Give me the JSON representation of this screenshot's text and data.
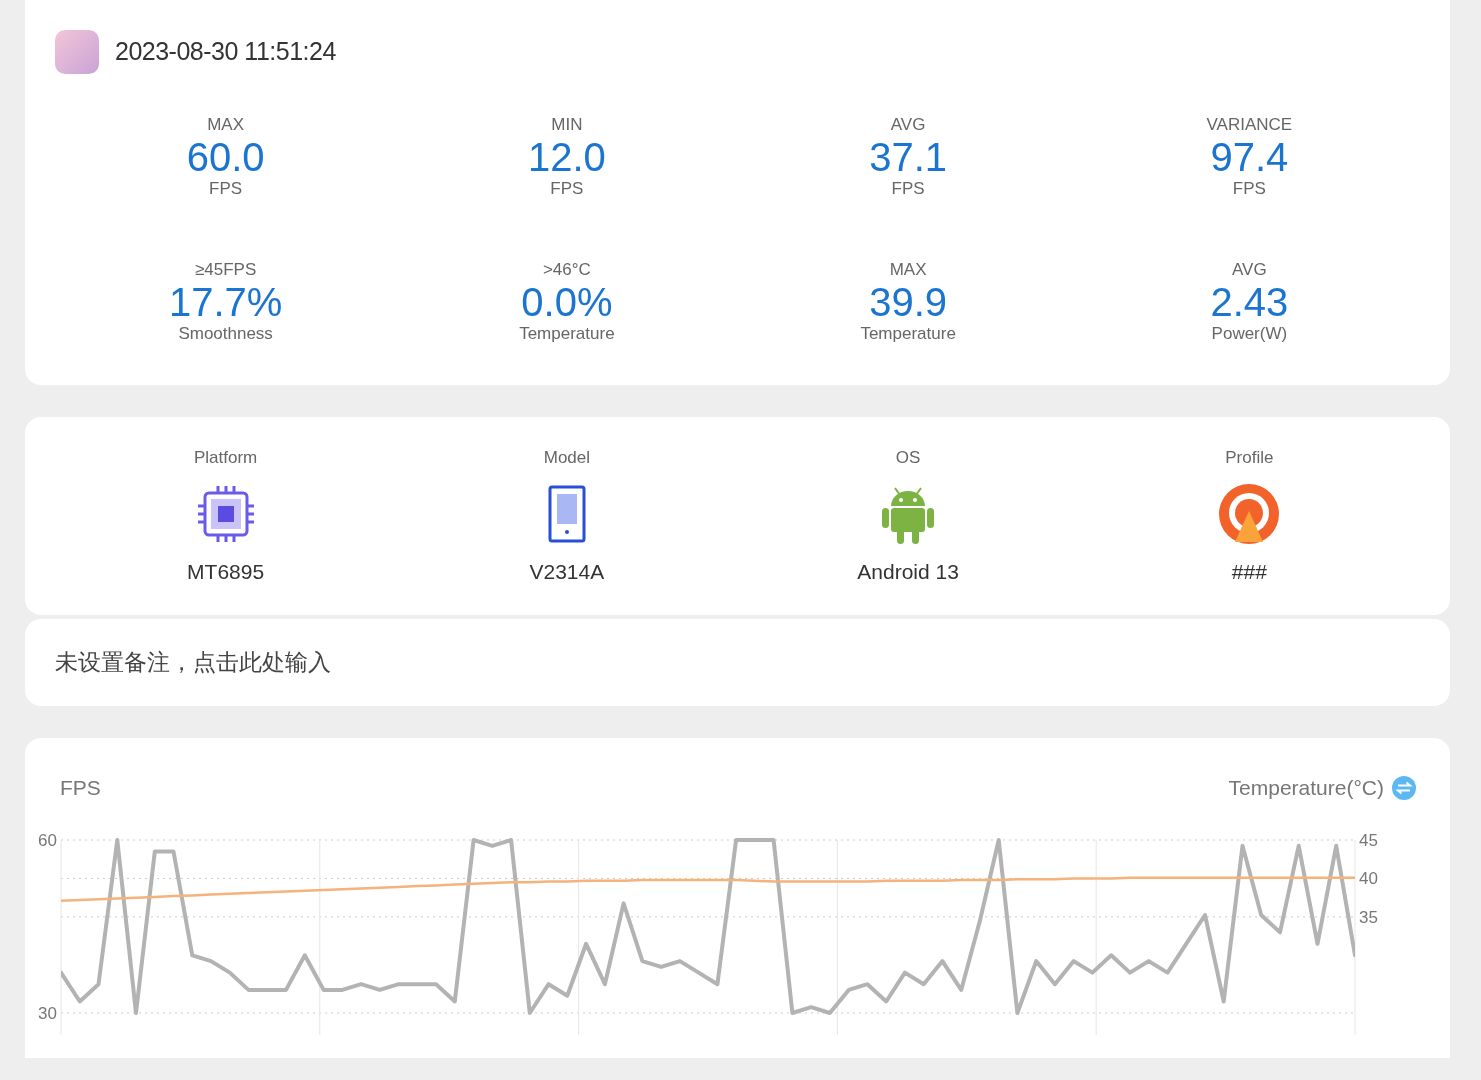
{
  "header": {
    "timestamp": "2023-08-30 11:51:24"
  },
  "stats": [
    {
      "label": "MAX",
      "value": "60.0",
      "unit": "FPS"
    },
    {
      "label": "MIN",
      "value": "12.0",
      "unit": "FPS"
    },
    {
      "label": "AVG",
      "value": "37.1",
      "unit": "FPS"
    },
    {
      "label": "VARIANCE",
      "value": "97.4",
      "unit": "FPS"
    },
    {
      "label": "≥45FPS",
      "value": "17.7%",
      "unit": "Smoothness"
    },
    {
      "label": ">46°C",
      "value": "0.0%",
      "unit": "Temperature"
    },
    {
      "label": "MAX",
      "value": "39.9",
      "unit": "Temperature"
    },
    {
      "label": "AVG",
      "value": "2.43",
      "unit": "Power(W)"
    }
  ],
  "device": [
    {
      "kind": "chip",
      "label": "Platform",
      "value": "MT6895"
    },
    {
      "kind": "tablet",
      "label": "Model",
      "value": "V2314A"
    },
    {
      "kind": "android",
      "label": "OS",
      "value": "Android 13"
    },
    {
      "kind": "profile",
      "label": "Profile",
      "value": "###"
    }
  ],
  "note": {
    "placeholder": "未设置备注，点击此处输入"
  },
  "chart": {
    "chart_data": {
      "type": "line",
      "grid": true,
      "ylim": [
        30,
        60
      ],
      "yticks": [
        30,
        60
      ],
      "y2lim": [
        22.5,
        45
      ],
      "y2ticks": [
        35,
        40,
        45
      ],
      "series": [
        {
          "name": "FPS",
          "color": "#b3b3b3",
          "values": [
            37,
            32,
            35,
            60,
            30,
            58,
            58,
            40,
            39,
            37,
            34,
            34,
            34,
            40,
            34,
            34,
            35,
            34,
            35,
            35,
            35,
            32,
            60,
            59,
            60,
            30,
            35,
            33,
            42,
            35,
            49,
            39,
            38,
            39,
            37,
            35,
            60,
            60,
            60,
            30,
            31,
            30,
            34,
            35,
            32,
            37,
            35,
            39,
            34,
            46,
            60,
            30,
            39,
            35,
            39,
            37,
            40,
            37,
            39,
            37,
            42,
            47,
            32,
            59,
            47,
            44,
            59,
            42,
            59,
            40
          ]
        },
        {
          "name": "Temperature(°C)",
          "color": "#f5b27a",
          "axis": "y2",
          "values": [
            37.1,
            37.2,
            37.3,
            37.4,
            37.5,
            37.6,
            37.7,
            37.8,
            37.9,
            38.0,
            38.1,
            38.2,
            38.3,
            38.4,
            38.5,
            38.6,
            38.7,
            38.8,
            38.9,
            39.0,
            39.1,
            39.2,
            39.3,
            39.4,
            39.5,
            39.5,
            39.6,
            39.6,
            39.7,
            39.7,
            39.7,
            39.8,
            39.8,
            39.8,
            39.8,
            39.8,
            39.8,
            39.7,
            39.6,
            39.6,
            39.6,
            39.6,
            39.6,
            39.6,
            39.7,
            39.7,
            39.7,
            39.7,
            39.8,
            39.8,
            39.8,
            39.9,
            39.9,
            39.9,
            40.0,
            40.0,
            40.0,
            40.1,
            40.1,
            40.1,
            40.1,
            40.1,
            40.1,
            40.1,
            40.1,
            40.1,
            40.1,
            40.1,
            40.1,
            40.1
          ]
        }
      ]
    }
  }
}
